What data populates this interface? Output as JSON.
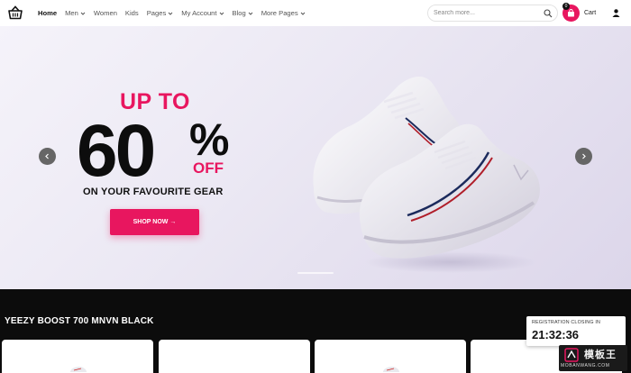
{
  "nav": {
    "items": [
      {
        "label": "Home",
        "active": true,
        "dropdown": false
      },
      {
        "label": "Men",
        "active": false,
        "dropdown": true
      },
      {
        "label": "Women",
        "active": false,
        "dropdown": false
      },
      {
        "label": "Kids",
        "active": false,
        "dropdown": false
      },
      {
        "label": "Pages",
        "active": false,
        "dropdown": true
      },
      {
        "label": "My Account",
        "active": false,
        "dropdown": true
      },
      {
        "label": "Blog",
        "active": false,
        "dropdown": true
      },
      {
        "label": "More Pages",
        "active": false,
        "dropdown": true
      }
    ]
  },
  "search": {
    "placeholder": "Search more..."
  },
  "cart": {
    "label": "Cart",
    "count": "0"
  },
  "hero": {
    "up_to": "UP TO",
    "number": "60",
    "percent": "%",
    "off": "OFF",
    "subtitle": "ON YOUR FAVOURITE GEAR",
    "cta": "SHOP NOW →"
  },
  "products": {
    "title": "YEEZY BOOST 700 MNVN BLACK"
  },
  "registration": {
    "label": "REGISTRATION CLOSING IN",
    "timer": "21:32:36"
  },
  "watermark": {
    "main": "模板王",
    "sub": "MOBANWANG.COM"
  },
  "colors": {
    "accent": "#e8165f",
    "dark": "#0c0c0c",
    "hero_bg": "#ece9f4"
  }
}
